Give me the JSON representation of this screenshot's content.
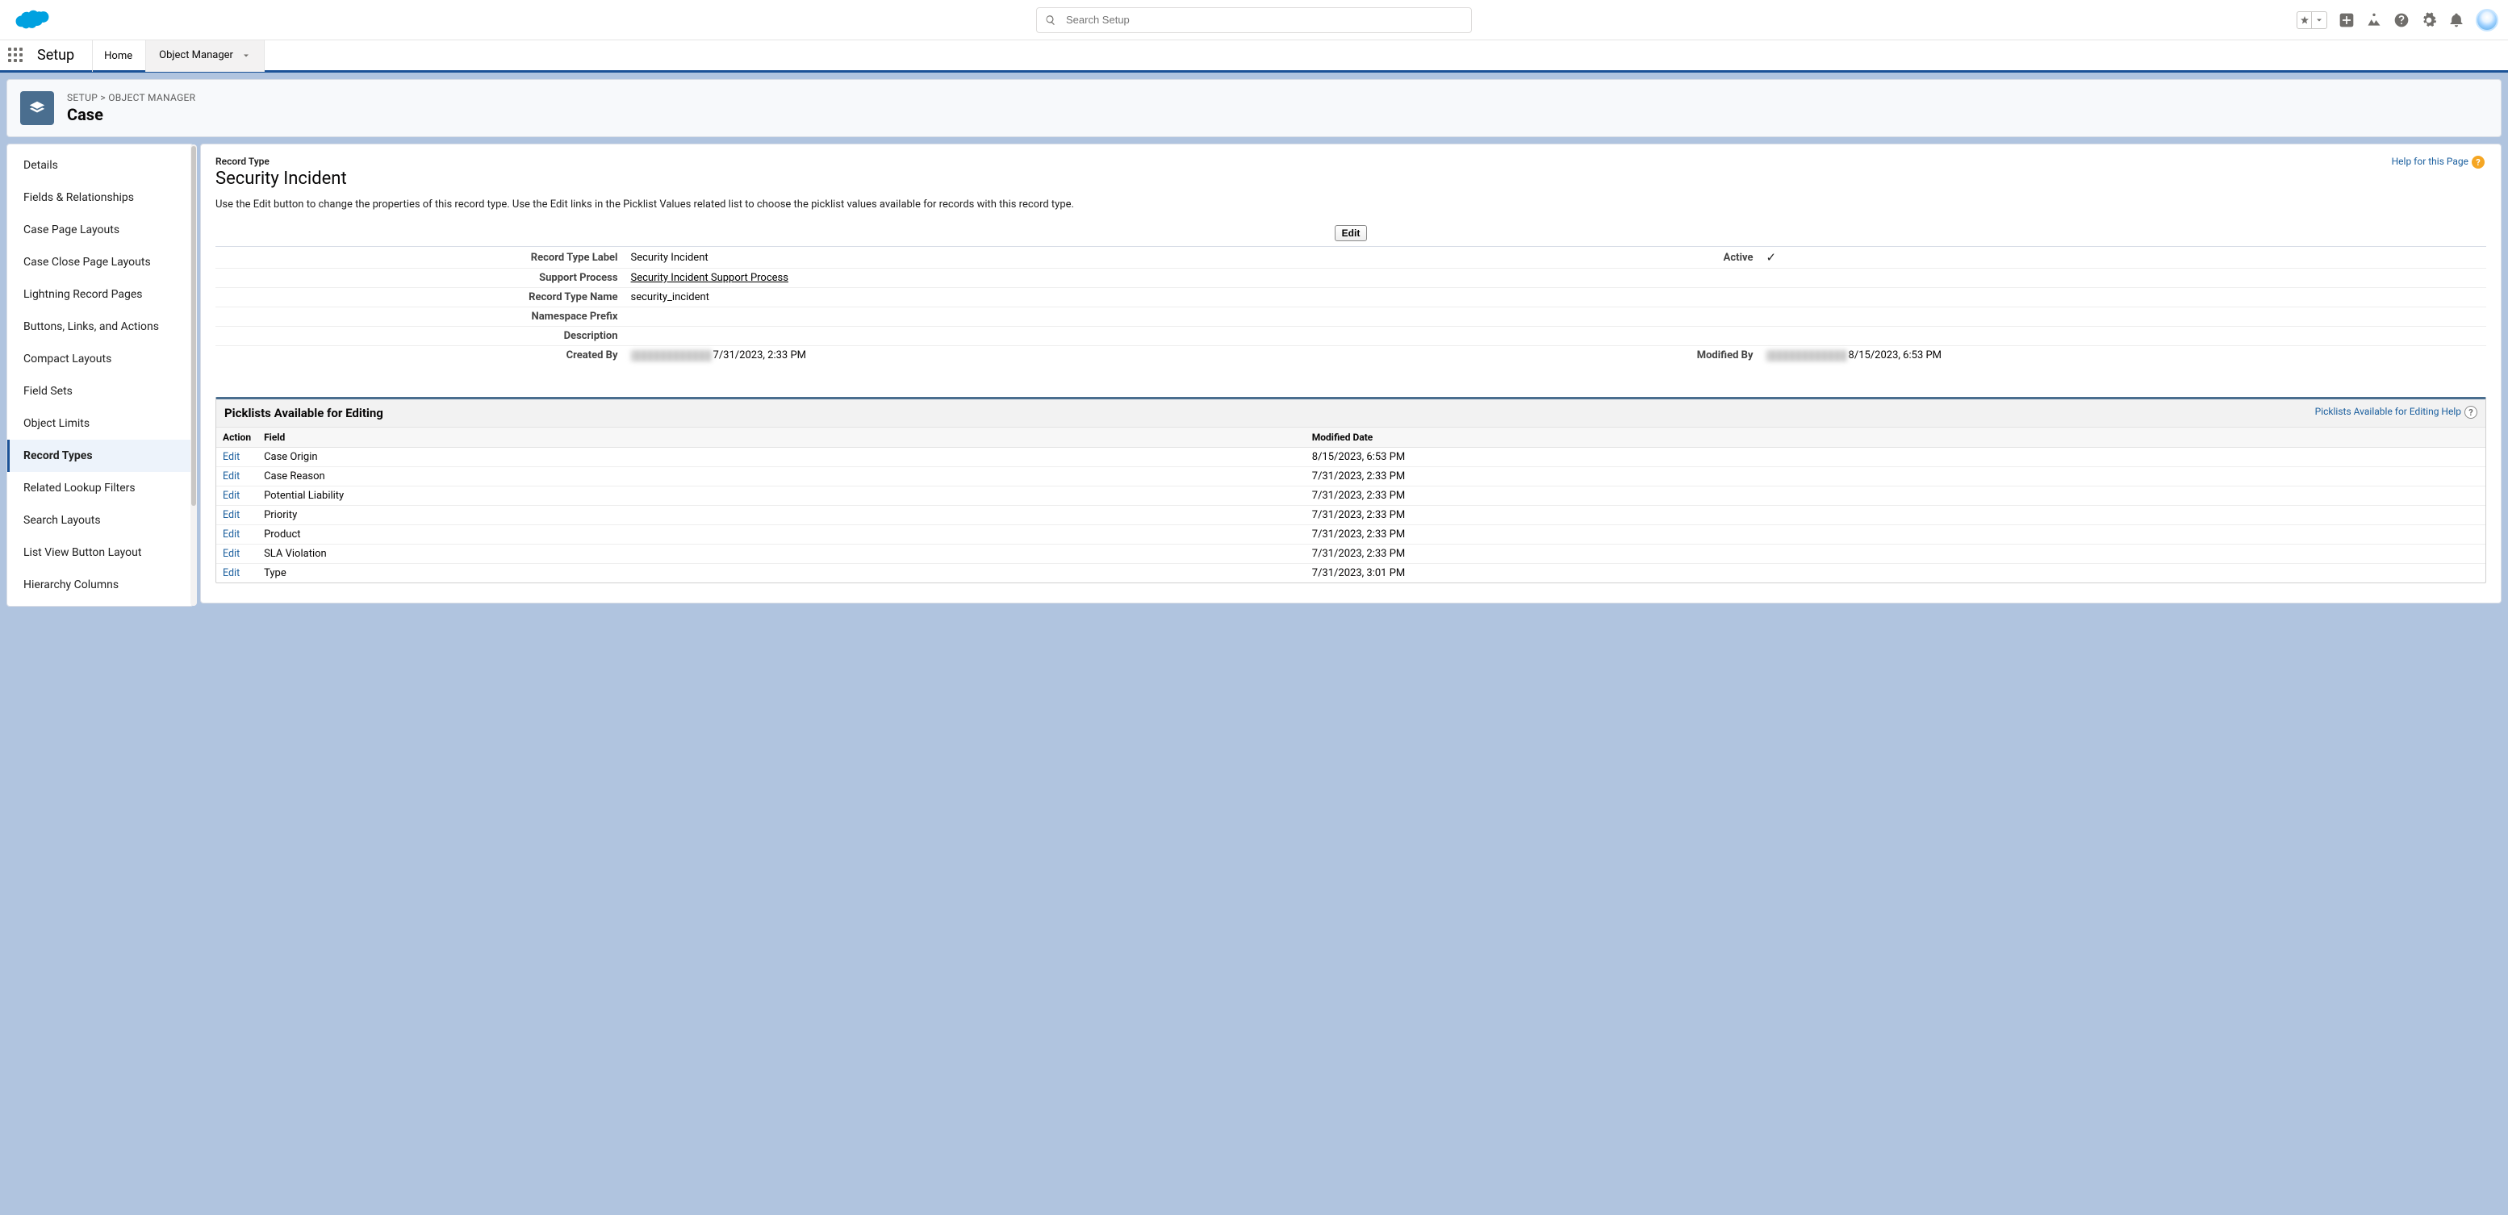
{
  "search": {
    "placeholder": "Search Setup"
  },
  "contextBar": {
    "appName": "Setup",
    "tabs": [
      {
        "label": "Home"
      },
      {
        "label": "Object Manager"
      }
    ]
  },
  "pageHeader": {
    "crumbSetup": "SETUP",
    "crumbSep": " > ",
    "crumbObjMgr": "OBJECT MANAGER",
    "title": "Case"
  },
  "sidebar": {
    "items": [
      "Details",
      "Fields & Relationships",
      "Case Page Layouts",
      "Case Close Page Layouts",
      "Lightning Record Pages",
      "Buttons, Links, and Actions",
      "Compact Layouts",
      "Field Sets",
      "Object Limits",
      "Record Types",
      "Related Lookup Filters",
      "Search Layouts",
      "List View Button Layout",
      "Hierarchy Columns"
    ]
  },
  "help": {
    "pageHelp": "Help for this Page",
    "section": "",
    "picklistHelp": "Picklists Available for Editing Help"
  },
  "recordType": {
    "section": "Record Type",
    "title": "Security Incident",
    "description": "Use the Edit button to change the properties of this record type. Use the Edit links in the Picklist Values related list to choose the picklist values available for records with this record type.",
    "editButton": "Edit",
    "labels": {
      "rtLabel": "Record Type Label",
      "supportProcess": "Support Process",
      "rtName": "Record Type Name",
      "nsPrefix": "Namespace Prefix",
      "description": "Description",
      "createdBy": "Created By",
      "active": "Active",
      "modifiedBy": "Modified By"
    },
    "values": {
      "rtLabel": "Security Incident",
      "supportProcess": "Security Incident Support Process",
      "rtName": "security_incident",
      "nsPrefix": "",
      "description": "",
      "createdDate": "7/31/2023, 2:33 PM",
      "modifiedDate": "8/15/2023, 6:53 PM",
      "active": "✓"
    }
  },
  "picklists": {
    "title": "Picklists Available for Editing",
    "columns": {
      "action": "Action",
      "field": "Field",
      "modified": "Modified Date"
    },
    "editLabel": "Edit",
    "rows": [
      {
        "field": "Case Origin",
        "modified": "8/15/2023, 6:53 PM"
      },
      {
        "field": "Case Reason",
        "modified": "7/31/2023, 2:33 PM"
      },
      {
        "field": "Potential Liability",
        "modified": "7/31/2023, 2:33 PM"
      },
      {
        "field": "Priority",
        "modified": "7/31/2023, 2:33 PM"
      },
      {
        "field": "Product",
        "modified": "7/31/2023, 2:33 PM"
      },
      {
        "field": "SLA Violation",
        "modified": "7/31/2023, 2:33 PM"
      },
      {
        "field": "Type",
        "modified": "7/31/2023, 3:01 PM"
      }
    ]
  }
}
